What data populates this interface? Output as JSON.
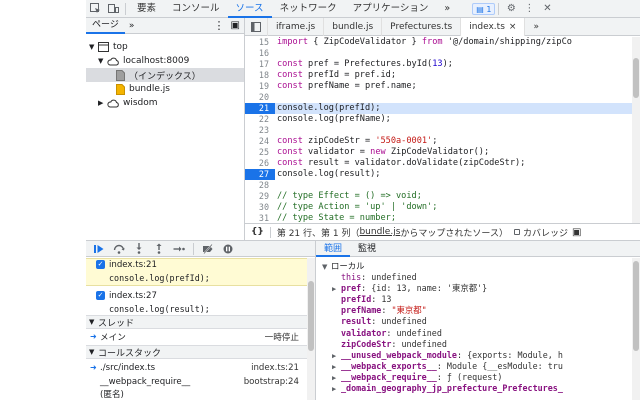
{
  "topbar": {
    "tabs": [
      "要素",
      "コンソール",
      "ソース",
      "ネットワーク",
      "アプリケーション"
    ],
    "active_tab": "ソース",
    "more": "»",
    "badge_count": "1",
    "icons": [
      "inspect-icon",
      "device-icon",
      "gear-icon",
      "kebab-icon",
      "close-icon"
    ]
  },
  "navigator": {
    "tab_label": "ページ",
    "more": "»",
    "tree": [
      {
        "label": "top",
        "icon": "frame-icon"
      },
      {
        "label": "localhost:8009",
        "icon": "cloud-icon"
      },
      {
        "label": "（インデックス）",
        "icon": "file-icon",
        "selected": true
      },
      {
        "label": "bundle.js",
        "icon": "file-js-icon"
      },
      {
        "label": "wisdom",
        "icon": "cloud-icon"
      }
    ]
  },
  "editor": {
    "tabs": [
      {
        "label": "iframe.js"
      },
      {
        "label": "bundle.js"
      },
      {
        "label": "Prefectures.ts"
      },
      {
        "label": "index.ts",
        "active": true,
        "close": "×"
      }
    ],
    "more": "»",
    "lines": [
      {
        "n": "15",
        "text": "import { ZipCodeValidator } from '@/domain/shipping/zipCo"
      },
      {
        "n": "16",
        "text": ""
      },
      {
        "n": "17",
        "text": "const pref = Prefectures.byId(13);"
      },
      {
        "n": "18",
        "text": "const prefId = pref.id;"
      },
      {
        "n": "19",
        "text": "const prefName = pref.name;"
      },
      {
        "n": "20",
        "text": ""
      },
      {
        "n": "21",
        "text": "console.log(prefId);",
        "breakpoint": true,
        "current": true
      },
      {
        "n": "22",
        "text": "console.log(prefName);"
      },
      {
        "n": "23",
        "text": ""
      },
      {
        "n": "24",
        "text": "const zipCodeStr = '550a-0001';"
      },
      {
        "n": "25",
        "text": "const validator = new ZipCodeValidator();"
      },
      {
        "n": "26",
        "text": "const result = validator.doValidate(zipCodeStr);"
      },
      {
        "n": "27",
        "text": "console.log(result);",
        "breakpoint": true
      },
      {
        "n": "28",
        "text": ""
      },
      {
        "n": "29",
        "text": "// type Effect = () => void;"
      },
      {
        "n": "30",
        "text": "// type Action = 'up' | 'down';"
      },
      {
        "n": "31",
        "text": "// type State = number;"
      }
    ],
    "status": {
      "braces": "{}",
      "position": "第 21 行、第 1 列",
      "source_prefix": "（",
      "source_link": "bundle.js",
      "source_suffix": " からマップされたソース）",
      "coverage": "カバレッジ"
    }
  },
  "debugger": {
    "breakpoints": [
      {
        "file": "index.ts:21",
        "code": "console.log(prefId);",
        "checked": "✓"
      },
      {
        "file": "index.ts:27",
        "code": "console.log(result);",
        "checked": "✓"
      }
    ],
    "threads_label": "スレッド",
    "thread": {
      "name": "メイン",
      "status": "一時停止"
    },
    "callstack_label": "コールスタック",
    "frames": [
      {
        "name": "./src/index.ts",
        "loc": "index.ts:21"
      },
      {
        "name": "__webpack_require__",
        "loc": "bootstrap:24"
      },
      {
        "name": "(匿名)",
        "loc": ""
      }
    ]
  },
  "scope": {
    "tabs": [
      "範囲",
      "監視"
    ],
    "active_tab": "範囲",
    "local_label": "ローカル",
    "rows": [
      {
        "name": "this",
        "sep": ": ",
        "value": "undefined",
        "bold": false,
        "expand": false
      },
      {
        "name": "pref",
        "sep": ": ",
        "value": "{id: 13, name: '東京都'}",
        "bold": true,
        "expand": true
      },
      {
        "name": "prefId",
        "sep": ": ",
        "value": "13",
        "bold": true,
        "expand": false
      },
      {
        "name": "prefName",
        "sep": ": ",
        "value": "\"東京都\"",
        "bold": true,
        "expand": false,
        "str": true
      },
      {
        "name": "result",
        "sep": ": ",
        "value": "undefined",
        "bold": true,
        "expand": false
      },
      {
        "name": "validator",
        "sep": ": ",
        "value": "undefined",
        "bold": true,
        "expand": false
      },
      {
        "name": "zipCodeStr",
        "sep": ": ",
        "value": "undefined",
        "bold": true,
        "expand": false
      },
      {
        "name": "__unused_webpack_module",
        "sep": ": ",
        "value": "{exports: Module, h",
        "bold": true,
        "expand": true
      },
      {
        "name": "__webpack_exports__",
        "sep": ": ",
        "value": "Module {__esModule: tru",
        "bold": true,
        "expand": true
      },
      {
        "name": "__webpack_require__",
        "sep": ": ",
        "value": "ƒ (request)",
        "bold": true,
        "expand": true
      },
      {
        "name": "_domain_geography_jp_prefecture_Prefectures_",
        "sep": "",
        "value": "",
        "bold": true,
        "expand": true
      }
    ]
  }
}
